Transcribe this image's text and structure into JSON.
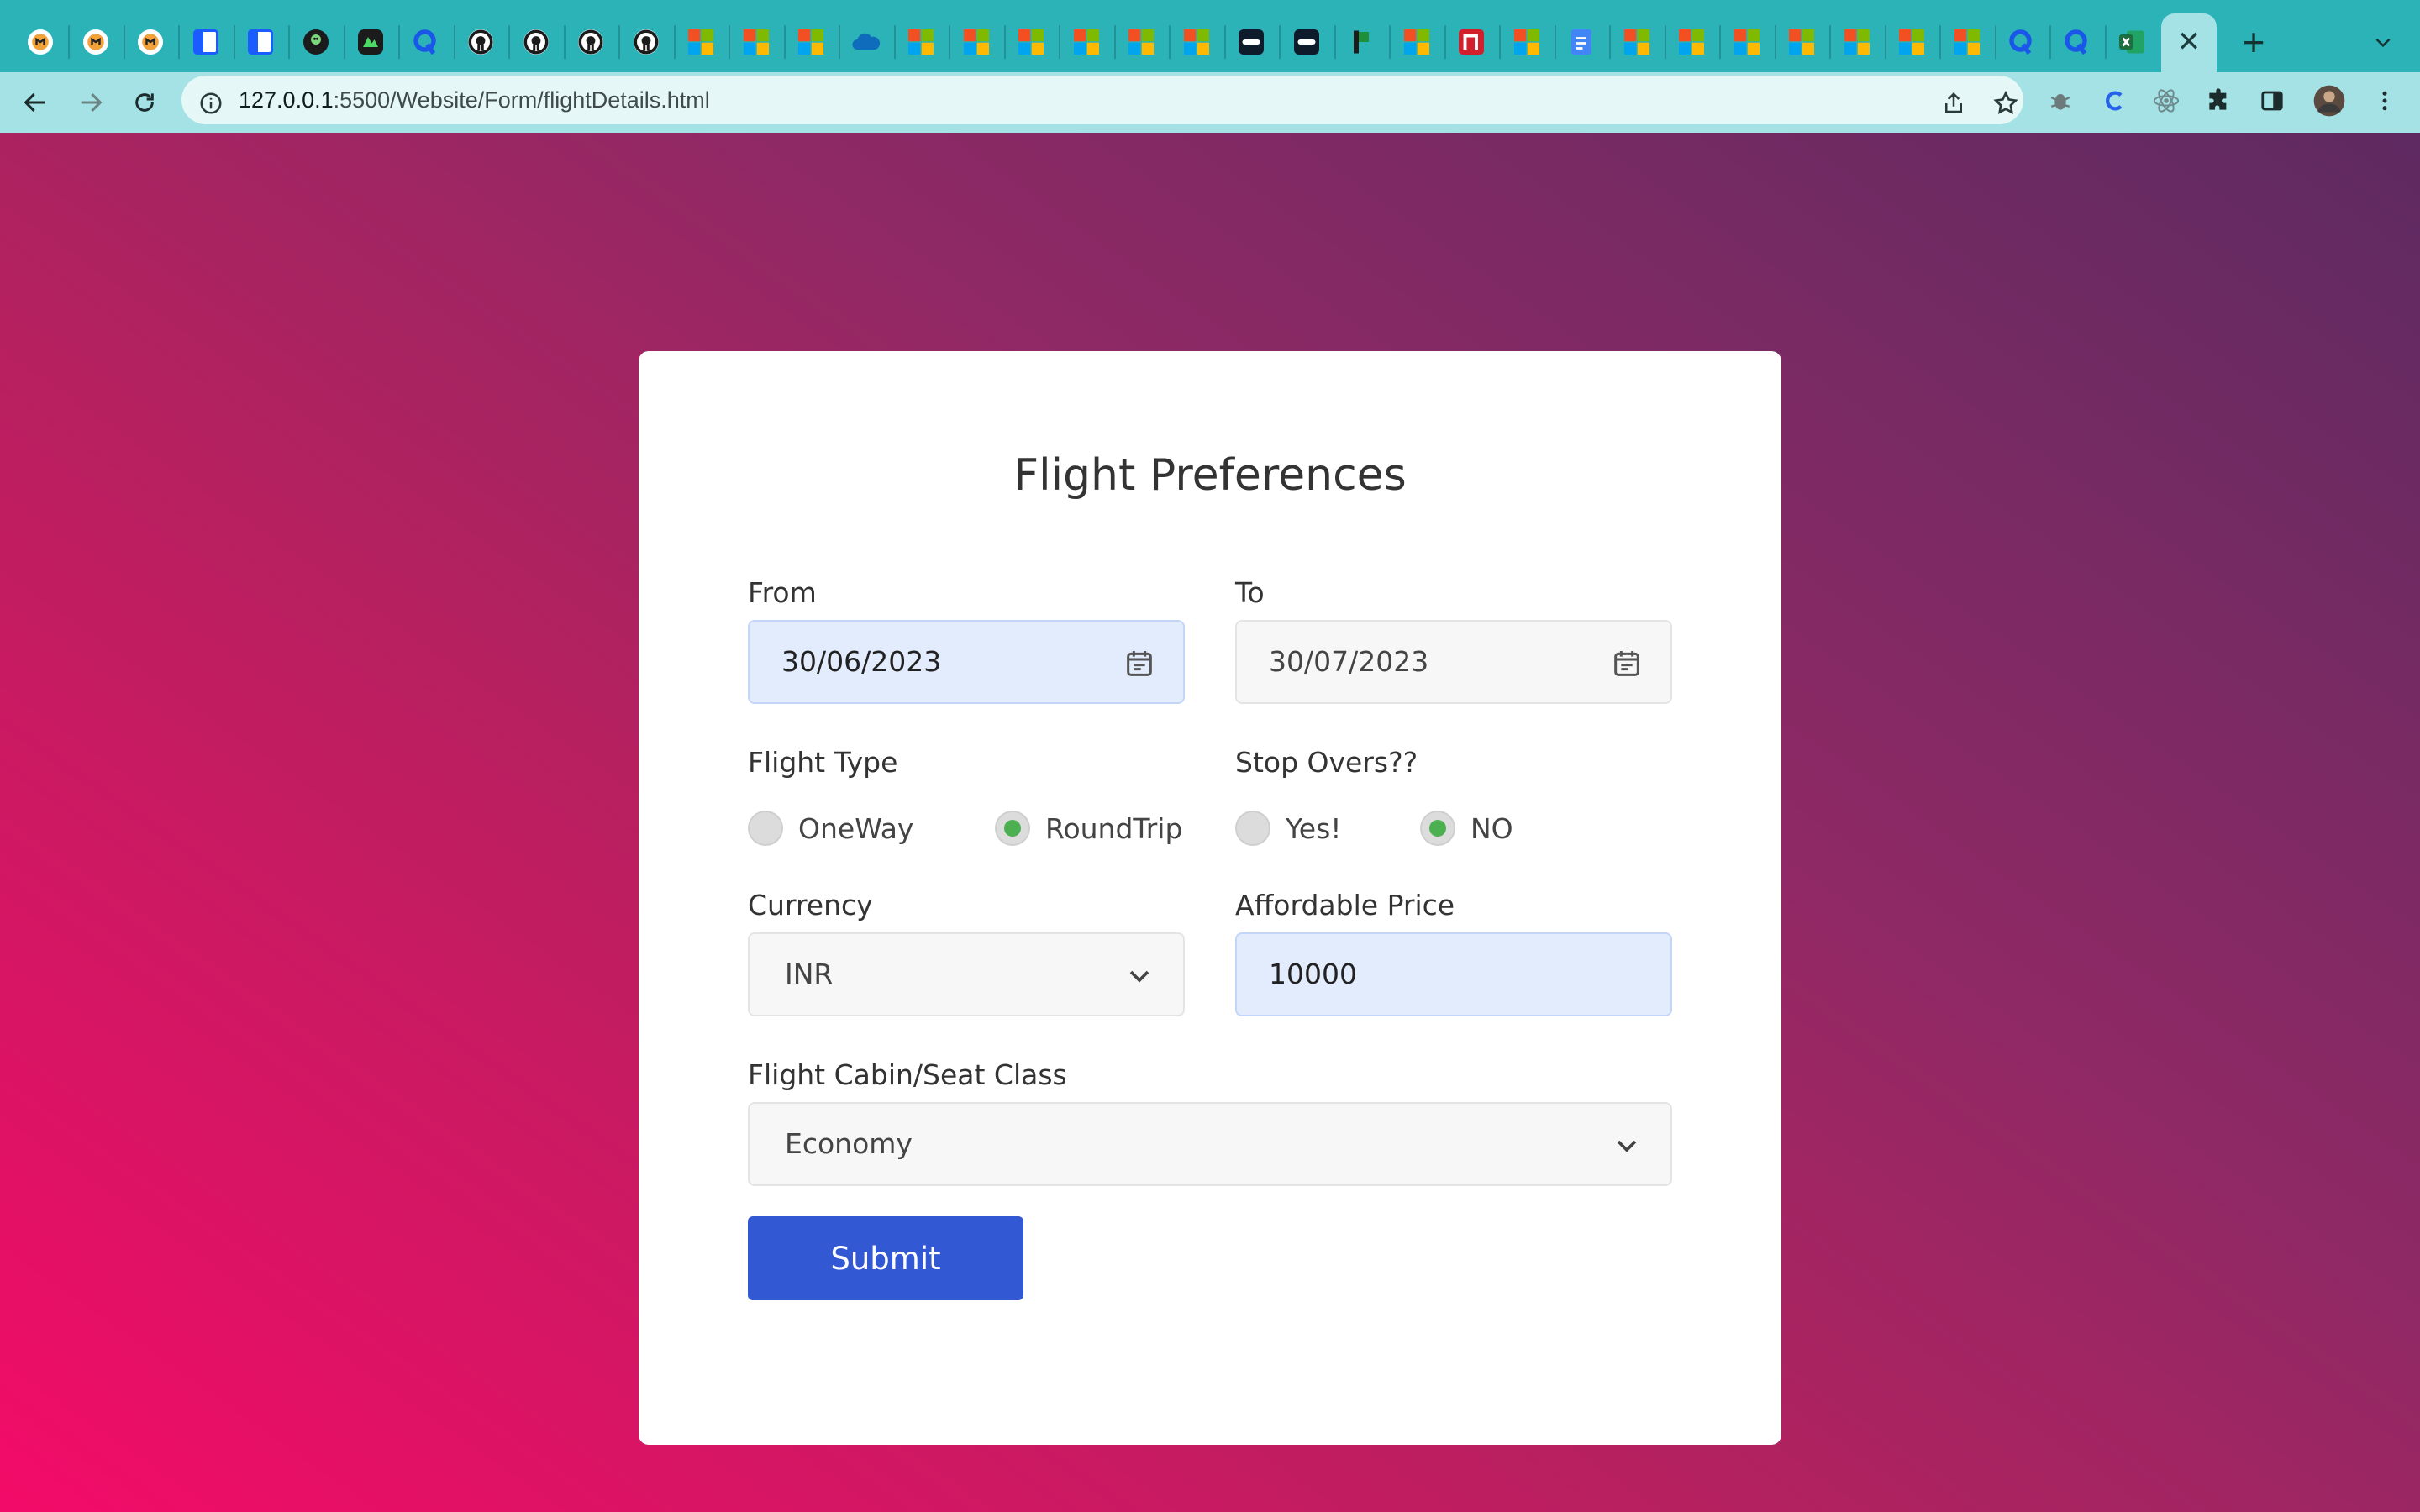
{
  "browser": {
    "tabs": [
      {
        "icon": "moodle-icon",
        "color": "#f2a23a"
      },
      {
        "icon": "moodle-icon",
        "color": "#f2a23a"
      },
      {
        "icon": "moodle-icon",
        "color": "#f2a23a"
      },
      {
        "icon": "sidebar-doc-icon",
        "color": "#1a5cff"
      },
      {
        "icon": "sidebar-doc-icon",
        "color": "#1a5cff"
      },
      {
        "icon": "octopus-icon",
        "color": "#1b1b1b"
      },
      {
        "icon": "green-app-icon",
        "color": "#2e7d32"
      },
      {
        "icon": "quora-q-icon",
        "color": "#1a56e8"
      },
      {
        "icon": "github-icon",
        "color": "#1b1b1b"
      },
      {
        "icon": "github-icon",
        "color": "#1b1b1b"
      },
      {
        "icon": "github-icon",
        "color": "#1b1b1b"
      },
      {
        "icon": "github-icon",
        "color": "#1b1b1b"
      },
      {
        "icon": "microsoft-icon",
        "color": "#f25022"
      },
      {
        "icon": "microsoft-icon",
        "color": "#f25022"
      },
      {
        "icon": "microsoft-icon",
        "color": "#f25022"
      },
      {
        "icon": "onedrive-cloud-icon",
        "color": "#0f6cbd"
      },
      {
        "icon": "microsoft-icon",
        "color": "#f25022"
      },
      {
        "icon": "microsoft-icon",
        "color": "#f25022"
      },
      {
        "icon": "microsoft-icon",
        "color": "#f25022"
      },
      {
        "icon": "microsoft-icon",
        "color": "#f25022"
      },
      {
        "icon": "microsoft-icon",
        "color": "#f25022"
      },
      {
        "icon": "microsoft-icon",
        "color": "#f25022"
      },
      {
        "icon": "dark-pill-icon",
        "color": "#0d1b2a"
      },
      {
        "icon": "dark-pill-icon",
        "color": "#0d1b2a"
      },
      {
        "icon": "green-flag-icon",
        "color": "#1f8f3a"
      },
      {
        "icon": "microsoft-icon",
        "color": "#f25022"
      },
      {
        "icon": "red-n-icon",
        "color": "#d21f2b"
      },
      {
        "icon": "microsoft-icon",
        "color": "#f25022"
      },
      {
        "icon": "google-docs-icon",
        "color": "#4285f4"
      },
      {
        "icon": "microsoft-icon",
        "color": "#f25022"
      },
      {
        "icon": "microsoft-icon",
        "color": "#f25022"
      },
      {
        "icon": "microsoft-icon",
        "color": "#f25022"
      },
      {
        "icon": "microsoft-icon",
        "color": "#f25022"
      },
      {
        "icon": "microsoft-icon",
        "color": "#f25022"
      },
      {
        "icon": "microsoft-icon",
        "color": "#f25022"
      },
      {
        "icon": "microsoft-icon",
        "color": "#f25022"
      },
      {
        "icon": "quora-q-icon",
        "color": "#1a56e8"
      },
      {
        "icon": "quora-q-icon",
        "color": "#1a56e8"
      },
      {
        "icon": "excel-icon",
        "color": "#1d6f42"
      }
    ],
    "active_tab_close": "✕",
    "new_tab": "+",
    "url_host": "127.0.0.1",
    "url_path": ":5500/Website/Form/flightDetails.html",
    "extensions": [
      "bug-extension-icon",
      "c-extension-icon",
      "react-devtools-icon",
      "puzzle-extensions-icon",
      "sidebar-toggle-icon",
      "profile-avatar",
      "more-menu-icon"
    ]
  },
  "form": {
    "title": "Flight Preferences",
    "from": {
      "label": "From",
      "value": "30/06/2023"
    },
    "to": {
      "label": "To",
      "value": "30/07/2023"
    },
    "flight_type": {
      "label": "Flight Type",
      "options": [
        {
          "label": "OneWay",
          "selected": false
        },
        {
          "label": "RoundTrip",
          "selected": true
        }
      ]
    },
    "stop_overs": {
      "label": "Stop Overs??",
      "options": [
        {
          "label": "Yes!",
          "selected": false
        },
        {
          "label": "NO",
          "selected": true
        }
      ]
    },
    "currency": {
      "label": "Currency",
      "value": "INR"
    },
    "price": {
      "label": "Affordable Price",
      "value": "10000"
    },
    "cabin": {
      "label": "Flight Cabin/Seat Class",
      "value": "Economy"
    },
    "submit_label": "Submit",
    "colors": {
      "accent": "#3358d4",
      "radio_on": "#4caf50",
      "autofill": "#e3ecfd"
    }
  }
}
